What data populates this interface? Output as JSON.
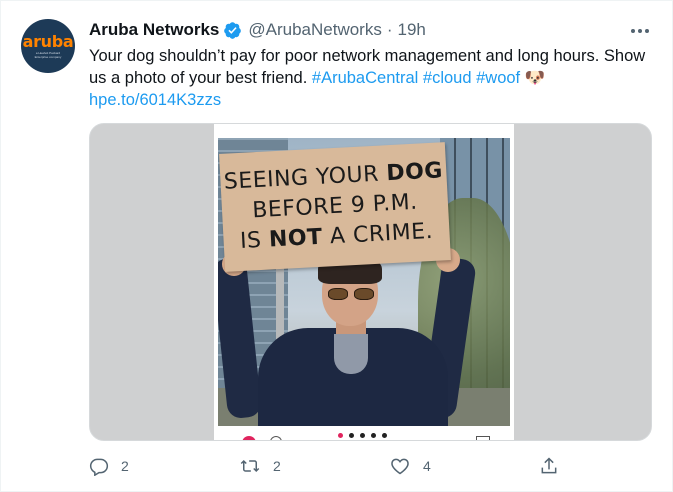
{
  "tweet": {
    "author": {
      "name": "Aruba Networks",
      "handle": "@ArubaNetworks",
      "verified": true,
      "avatar_logo_text": "aruba",
      "avatar_sub_text": "a Hewlett Packard Enterprise company"
    },
    "separator": "·",
    "time": "19h",
    "more_icon": "more-horizontal-icon",
    "text": {
      "line1": "Your dog shouldn’t pay for poor network management and long hours. Show",
      "line2_plain": "us a photo of your best friend. ",
      "hashtags": [
        "#ArubaCentral",
        "#cloud",
        "#woof"
      ],
      "emoji": "🐶",
      "link": "hpe.to/6014K3zzs"
    },
    "media": {
      "sign_lines": [
        {
          "pre": "SEEING YOUR ",
          "bold": "DOG",
          "post": ""
        },
        {
          "pre": "BEFORE 9 P.M.",
          "bold": "",
          "post": ""
        },
        {
          "pre": "IS ",
          "bold": "NOT",
          "post": " A CRIME."
        }
      ],
      "carousel_active_index": 0,
      "carousel_count": 5
    },
    "actions": {
      "reply_count": "2",
      "retweet_count": "2",
      "like_count": "4",
      "share_icon": "share-icon"
    }
  },
  "colors": {
    "link": "#1d9bf0",
    "text": "#0f1419",
    "muted": "#536471",
    "verified": "#1d9bf0",
    "brand_orange": "#ff8300",
    "avatar_bg": "#1d3a57"
  }
}
